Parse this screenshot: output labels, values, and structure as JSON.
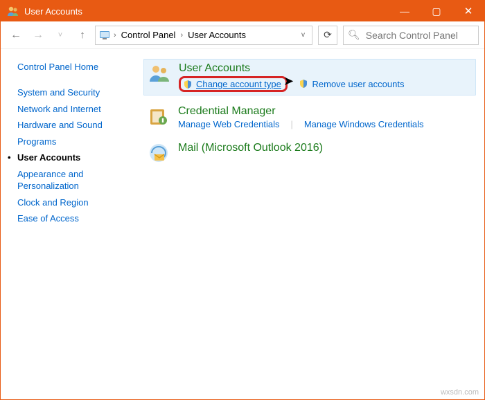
{
  "title": "User Accounts",
  "win": {
    "min": "—",
    "max": "▢",
    "close": "✕"
  },
  "nav": {
    "back": "←",
    "forward": "→",
    "recent": "˅",
    "up": "↑"
  },
  "breadcrumb": {
    "item0": "Control Panel",
    "item1": "User Accounts"
  },
  "refresh_glyph": "⟳",
  "search": {
    "placeholder": "Search Control Panel"
  },
  "sidebar": {
    "home": "Control Panel Home",
    "items": [
      "System and Security",
      "Network and Internet",
      "Hardware and Sound",
      "Programs",
      "User Accounts",
      "Appearance and Personalization",
      "Clock and Region",
      "Ease of Access"
    ]
  },
  "groups": {
    "ua": {
      "title": "User Accounts",
      "change": "Change account type",
      "remove": "Remove user accounts"
    },
    "cm": {
      "title": "Credential Manager",
      "web": "Manage Web Credentials",
      "win": "Manage Windows Credentials"
    },
    "mail": {
      "title": "Mail (Microsoft Outlook 2016)"
    }
  },
  "watermark": "wxsdn.com"
}
